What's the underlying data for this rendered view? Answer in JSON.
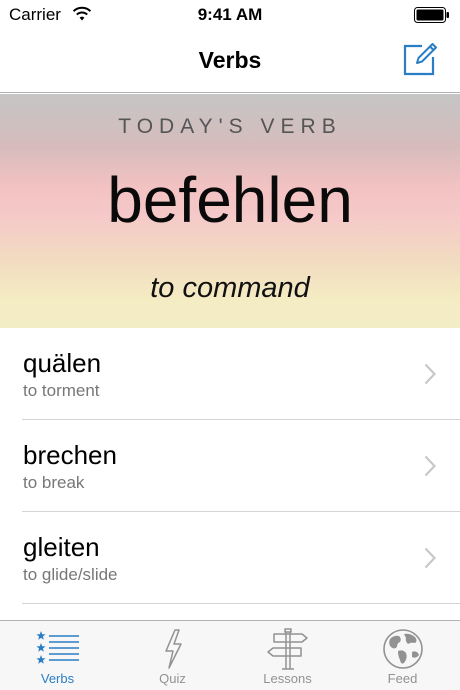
{
  "status_bar": {
    "carrier": "Carrier",
    "time": "9:41 AM"
  },
  "nav": {
    "title": "Verbs",
    "compose_icon": "compose-icon"
  },
  "hero": {
    "kicker": "TODAY'S VERB",
    "verb": "befehlen",
    "translation": "to command"
  },
  "verbs": [
    {
      "verb": "quälen",
      "meaning": "to torment"
    },
    {
      "verb": "brechen",
      "meaning": "to break"
    },
    {
      "verb": "gleiten",
      "meaning": "to glide/slide"
    }
  ],
  "tabs": [
    {
      "label": "Verbs",
      "icon": "starred-list-icon",
      "active": true
    },
    {
      "label": "Quiz",
      "icon": "lightning-icon",
      "active": false
    },
    {
      "label": "Lessons",
      "icon": "signpost-icon",
      "active": false
    },
    {
      "label": "Feed",
      "icon": "globe-icon",
      "active": false
    }
  ],
  "colors": {
    "accent": "#2a7ec4",
    "inactive_tab": "#929292",
    "divider": "#d4d4d4"
  }
}
